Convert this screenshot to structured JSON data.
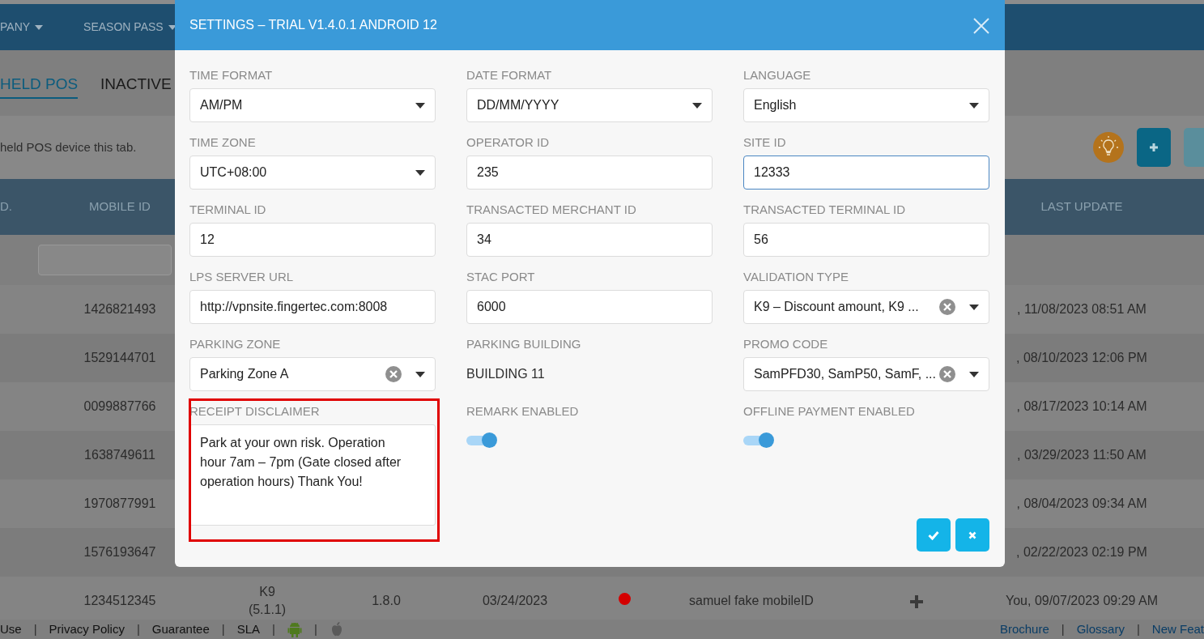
{
  "navbar": {
    "items": [
      {
        "label": "PANY"
      },
      {
        "label": "SEASON PASS"
      }
    ]
  },
  "tabs": [
    {
      "label": "HELD POS",
      "selected": true
    },
    {
      "label": "INACTIVE",
      "selected": false
    }
  ],
  "info_text": "held POS device this tab.",
  "table": {
    "columns": {
      "no": "D.",
      "mobile_id": "MOBILE ID",
      "last_update": "LAST UPDATE"
    },
    "rows": [
      {
        "mobile_id": "1426821493",
        "last_update": ", 11/08/2023 08:51 AM"
      },
      {
        "mobile_id": "1529144701",
        "last_update": ", 08/10/2023 12:06 PM"
      },
      {
        "mobile_id": "0099887766",
        "last_update": ", 08/17/2023 10:14 AM"
      },
      {
        "mobile_id": "1638749611",
        "last_update": ", 03/29/2023 11:50 AM"
      },
      {
        "mobile_id": "1970877991",
        "last_update": ", 08/04/2023 09:34 AM"
      },
      {
        "mobile_id": "1576193647",
        "last_update": ", 02/22/2023 02:19 PM"
      },
      {
        "mobile_id": "1234512345",
        "model": "K9",
        "model_version": "(5.1.1)",
        "version": "1.8.0",
        "date": "03/24/2023",
        "color": "#d40000",
        "remark": "samuel fake mobileID",
        "last_update": "You, 09/07/2023 09:29 AM"
      }
    ]
  },
  "footer": {
    "left": [
      {
        "kind": "link",
        "text": "Use"
      },
      {
        "kind": "separator",
        "text": "|"
      },
      {
        "kind": "link",
        "text": "Privacy Policy"
      },
      {
        "kind": "separator",
        "text": "|"
      },
      {
        "kind": "link",
        "text": "Guarantee"
      },
      {
        "kind": "separator",
        "text": "|"
      },
      {
        "kind": "link",
        "text": "SLA"
      },
      {
        "kind": "separator",
        "text": "|"
      },
      {
        "kind": "icon"
      },
      {
        "kind": "separator",
        "text": "|"
      },
      {
        "kind": "icon"
      }
    ],
    "right": [
      {
        "kind": "link",
        "text": "Brochure"
      },
      {
        "kind": "separator",
        "text": "|"
      },
      {
        "kind": "link",
        "text": "Glossary"
      },
      {
        "kind": "separator",
        "text": "|"
      },
      {
        "kind": "link",
        "text": "New Feat"
      }
    ]
  },
  "modal": {
    "title": "SETTINGS – TRIAL V1.4.0.1 ANDROID 12",
    "fields": [
      {
        "kind": "select",
        "label": "TIME FORMAT",
        "value": "AM/PM"
      },
      {
        "kind": "select",
        "label": "DATE FORMAT",
        "value": "DD/MM/YYYY"
      },
      {
        "kind": "select",
        "label": "LANGUAGE",
        "value": "English"
      },
      {
        "kind": "select",
        "label": "TIME ZONE",
        "value": "UTC+08:00"
      },
      {
        "kind": "input",
        "label": "OPERATOR ID",
        "value": "235",
        "focused": false
      },
      {
        "kind": "input",
        "label": "SITE ID",
        "value": "12333",
        "focused": true
      },
      {
        "kind": "input",
        "label": "TERMINAL ID",
        "value": "12",
        "focused": false
      },
      {
        "kind": "input",
        "label": "TRANSACTED MERCHANT ID",
        "value": "34",
        "focused": false
      },
      {
        "kind": "input",
        "label": "TRANSACTED TERMINAL ID",
        "value": "56",
        "focused": false
      },
      {
        "kind": "input",
        "label": "LPS SERVER URL",
        "value": "http://vpnsite.fingertec.com:8008",
        "focused": false
      },
      {
        "kind": "input",
        "label": "STAC PORT",
        "value": "6000",
        "focused": false
      },
      {
        "kind": "select_clear",
        "label": "VALIDATION TYPE",
        "value": "K9 – Discount amount, K9 ..."
      },
      {
        "kind": "select_clear",
        "label": "PARKING ZONE",
        "value": "Parking Zone A"
      },
      {
        "kind": "text",
        "label": "PARKING BUILDING",
        "value": "BUILDING 11"
      },
      {
        "kind": "select_clear",
        "label": "PROMO CODE",
        "value": "SamPFD30, SamP50, SamF, ..."
      },
      {
        "kind": "textarea",
        "label": "RECEIPT DISCLAIMER",
        "value": "Park at your own risk. Operation hour 7am – 7pm (Gate closed after operation hours) Thank You!",
        "highlighted": true
      },
      {
        "kind": "toggle",
        "label": "REMARK ENABLED",
        "on": true
      },
      {
        "kind": "toggle",
        "label": "OFFLINE PAYMENT ENABLED",
        "on": true
      }
    ]
  }
}
